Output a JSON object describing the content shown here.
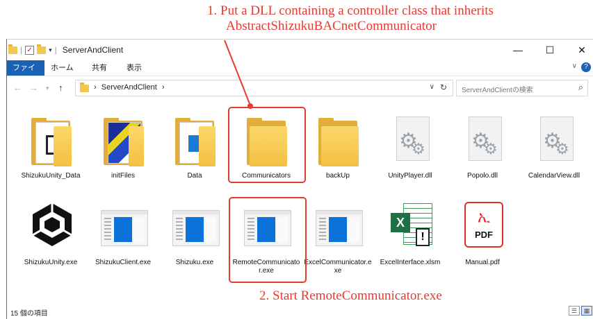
{
  "annotations": {
    "step1_line1": "1. Put a DLL containing a controller class that inherits",
    "step1_line2": "AbstractShizukuBACnetCommunicator",
    "step2": "2. Start RemoteCommunicator.exe",
    "color": "#e8392f"
  },
  "window": {
    "title": "ServerAndClient",
    "minimize": "—",
    "maximize": "☐",
    "close": "✕"
  },
  "ribbon": {
    "tabs": [
      "ファイル",
      "ホーム",
      "共有",
      "表示"
    ],
    "help": "?"
  },
  "address": {
    "path": "ServerAndClient",
    "separator": "›",
    "search_placeholder": "ServerAndClientの検索"
  },
  "items": [
    {
      "name": "ShizukuUnity_Data",
      "type": "folder-dark"
    },
    {
      "name": "initFiles",
      "type": "folder-image"
    },
    {
      "name": "Data",
      "type": "folder-blue"
    },
    {
      "name": "Communicators",
      "type": "folder",
      "highlighted": true
    },
    {
      "name": "backUp",
      "type": "folder"
    },
    {
      "name": "UnityPlayer.dll",
      "type": "dll"
    },
    {
      "name": "Popolo.dll",
      "type": "dll"
    },
    {
      "name": "CalendarView.dll",
      "type": "dll"
    },
    {
      "name": "ShizukuUnity.exe",
      "type": "unity"
    },
    {
      "name": "ShizukuClient.exe",
      "type": "exe"
    },
    {
      "name": "Shizuku.exe",
      "type": "exe"
    },
    {
      "name": "RemoteCommunicator.exe",
      "type": "exe",
      "highlighted": true
    },
    {
      "name": "ExcelCommunicator.exe",
      "type": "exe"
    },
    {
      "name": "ExcelInterface.xlsm",
      "type": "excel"
    },
    {
      "name": "Manual.pdf",
      "type": "pdf",
      "highlighted": true
    }
  ],
  "icons": {
    "pdf_badge": "PDF",
    "excel_badge": "X",
    "excel_warn": "!",
    "acrobat_glyph": "ኢ"
  },
  "status": {
    "count": "15 個の項目"
  }
}
